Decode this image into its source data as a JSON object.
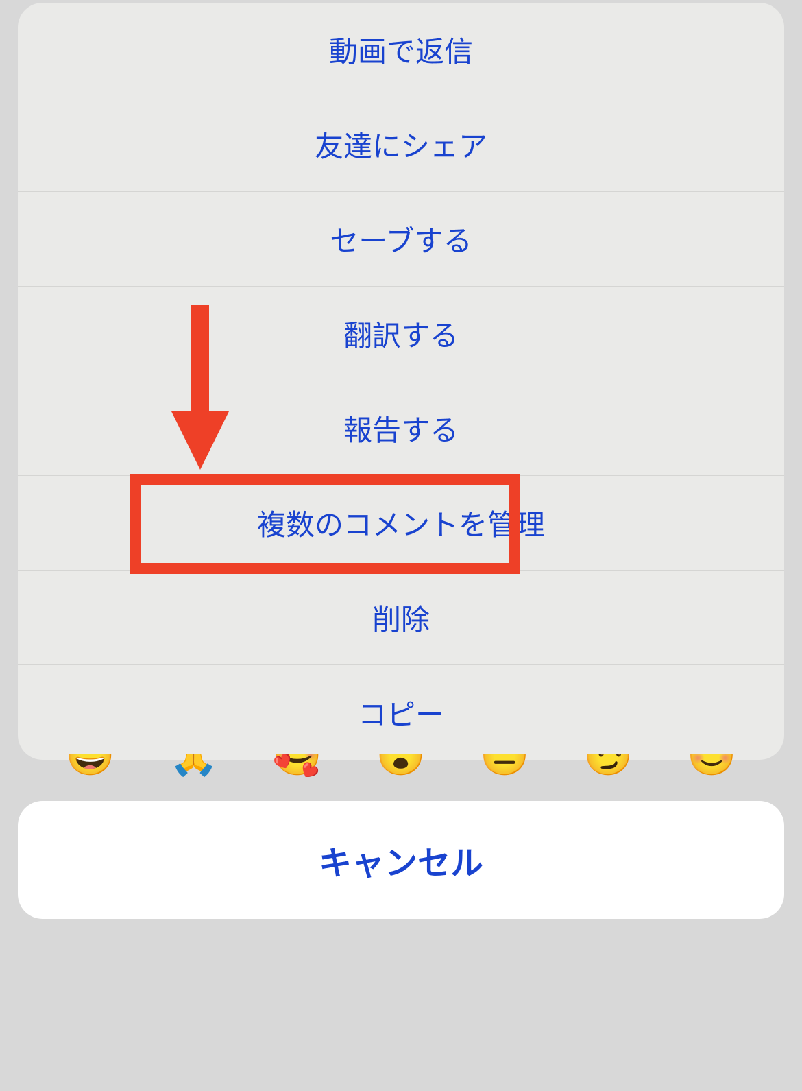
{
  "actionSheet": {
    "items": [
      {
        "label": "動画で返信",
        "name": "reply-with-video"
      },
      {
        "label": "友達にシェア",
        "name": "share-to-friends"
      },
      {
        "label": "セーブする",
        "name": "save"
      },
      {
        "label": "翻訳する",
        "name": "translate"
      },
      {
        "label": "報告する",
        "name": "report"
      },
      {
        "label": "複数のコメントを管理",
        "name": "manage-multiple-comments"
      },
      {
        "label": "削除",
        "name": "delete"
      },
      {
        "label": "コピー",
        "name": "copy"
      }
    ],
    "cancel": "キャンセル"
  },
  "emojis": [
    "😀",
    "🙏",
    "🥰",
    "😮",
    "😑",
    "😏",
    "😊"
  ],
  "annotation": {
    "arrowColor": "#ee4027",
    "highlightColor": "#ee4027",
    "highlightedItemIndex": 5
  }
}
